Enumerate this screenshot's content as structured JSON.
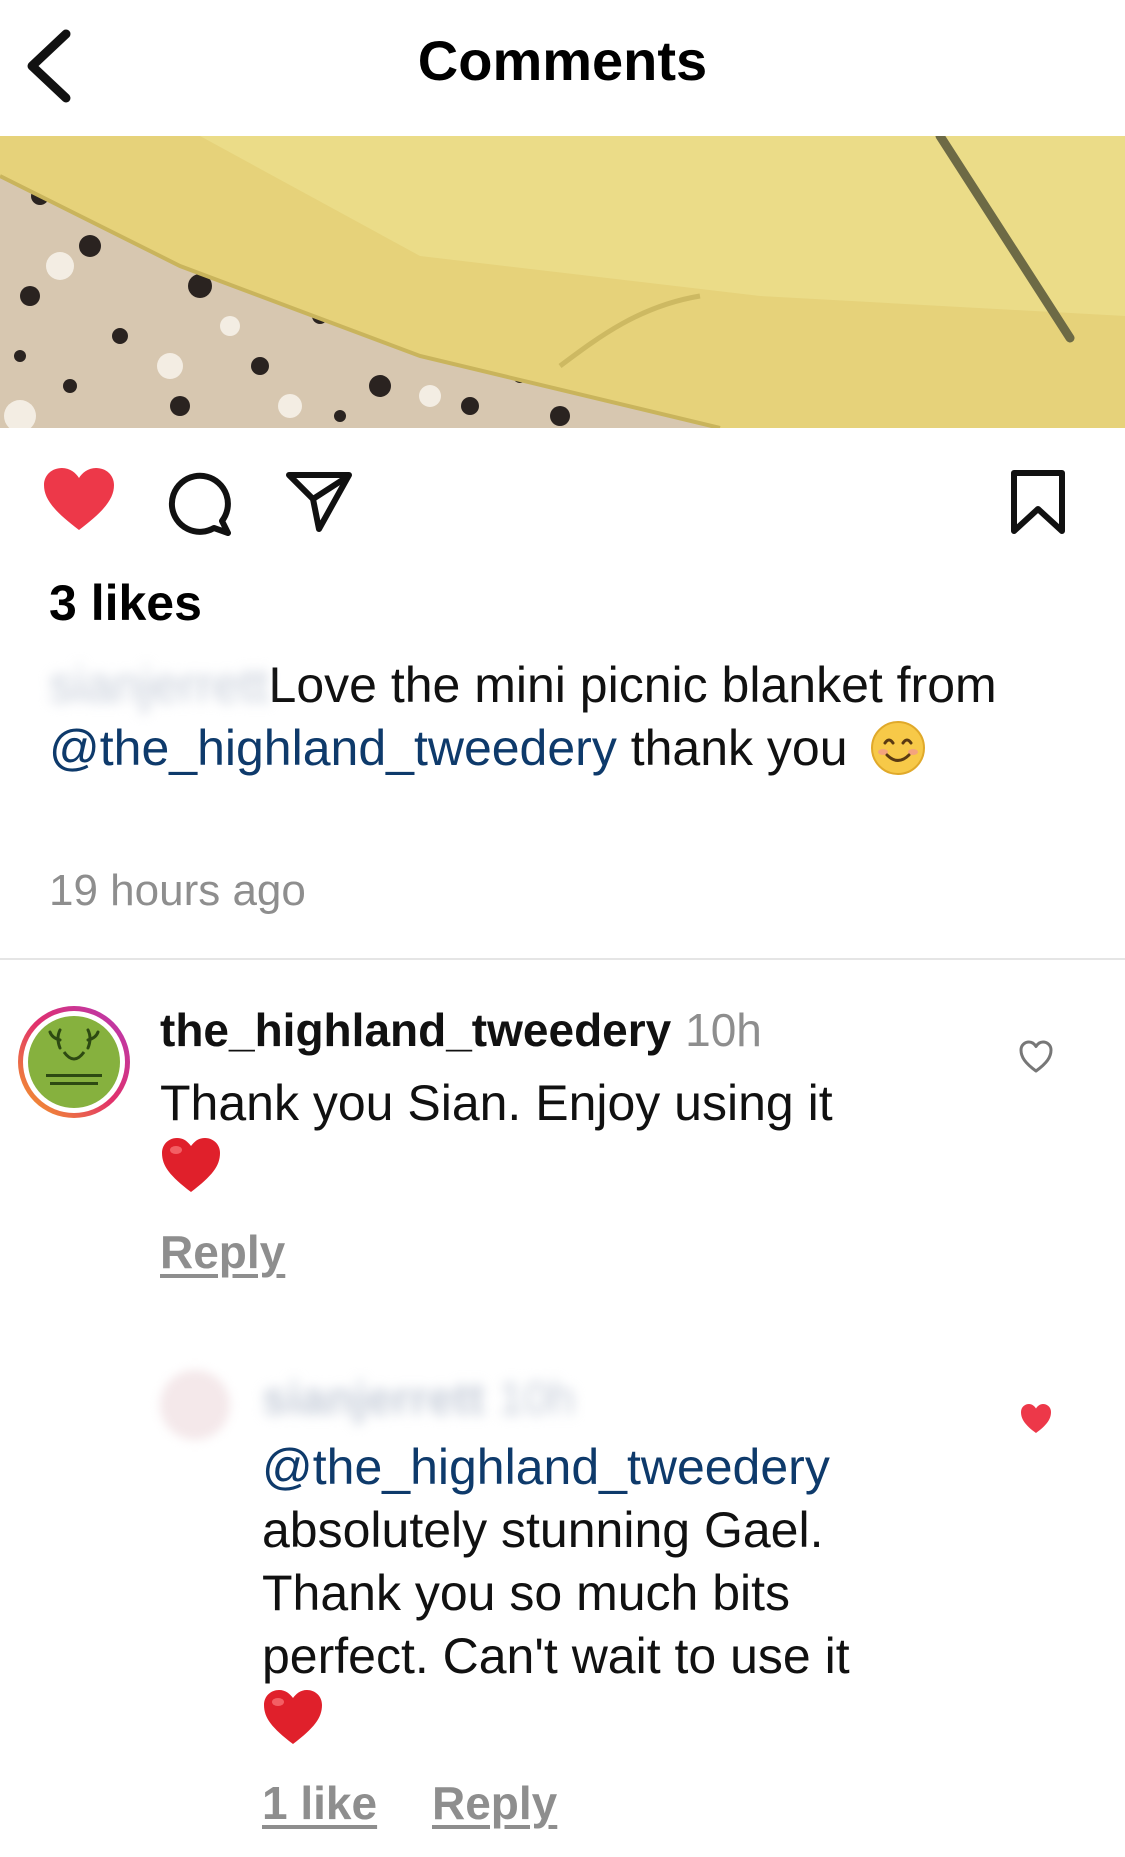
{
  "header": {
    "title": "Comments"
  },
  "post": {
    "likes": "3 likes",
    "caption": {
      "username_blurred": "sianjerrett",
      "text_before_mention": "Love the mini picnic blanket from ",
      "mention": "@the_highland_tweedery",
      "text_after_mention": " thank you",
      "emoji": "smiling-face-icon"
    },
    "time_ago": "19 hours ago"
  },
  "comments": [
    {
      "username": "the_highland_tweedery",
      "time": "10h",
      "text": "Thank you Sian. Enjoy using it",
      "emoji": "red-heart",
      "reply_label": "Reply",
      "liked": false
    },
    {
      "username_blurred": "sianjerrett",
      "time_blurred": "10h",
      "mention": "@the_highland_tweedery",
      "text_lines": [
        "absolutely stunning Gael.",
        "Thank you so much bits",
        "perfect. Can't wait to use it"
      ],
      "emoji": "red-heart",
      "likes_label": "1 like",
      "reply_label": "Reply",
      "liked": true
    }
  ],
  "colors": {
    "like_red": "#ed3849",
    "mention_blue": "#0e3a6b",
    "muted_gray": "#8e8e8e"
  }
}
